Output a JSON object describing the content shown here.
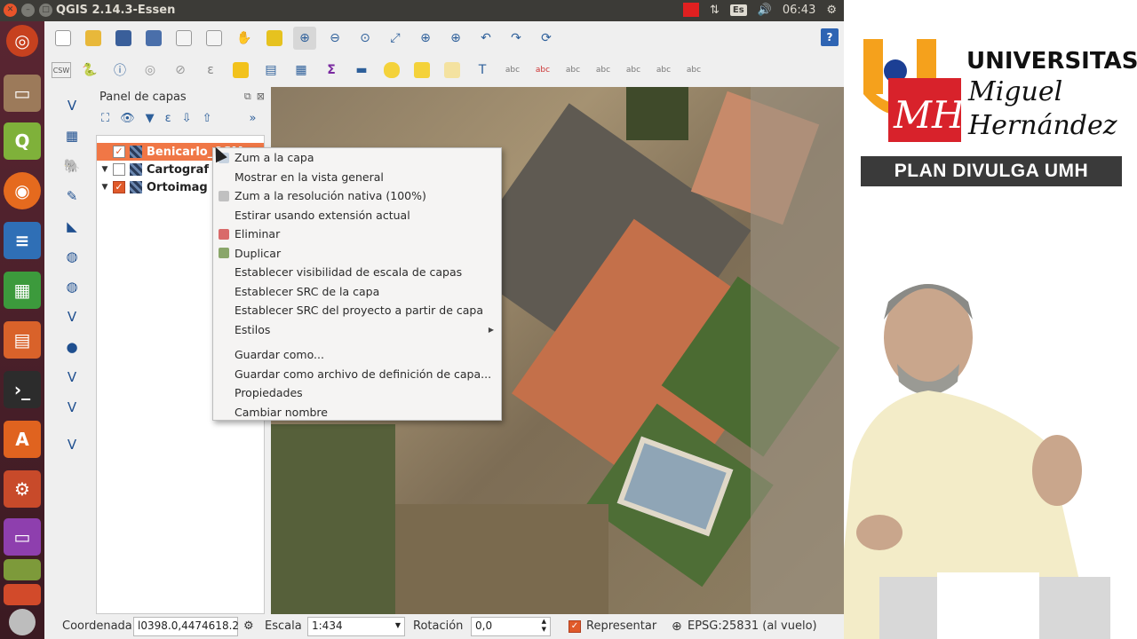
{
  "window": {
    "title": "QGIS 2.14.3-Essen"
  },
  "tray": {
    "keyboard": "Es",
    "clock": "06:43"
  },
  "panel": {
    "title": "Panel de capas"
  },
  "layers": [
    {
      "name": "Benicarlo_OSM",
      "checked": true,
      "selected": true
    },
    {
      "name": "Cartograf",
      "checked": false,
      "selected": false
    },
    {
      "name": "Ortoimag",
      "checked": true,
      "selected": false
    }
  ],
  "context_menu": {
    "items": [
      {
        "label": "Zum a la capa",
        "icon": "zoom-layer-icon"
      },
      {
        "label": "Mostrar en la vista general",
        "icon": ""
      },
      {
        "label": "Zum a la resolución nativa (100%)",
        "icon": "zoom-native-icon"
      },
      {
        "label": "Estirar usando extensión actual",
        "icon": ""
      },
      {
        "label": "Eliminar",
        "icon": "remove-icon"
      },
      {
        "label": "Duplicar",
        "icon": "duplicate-icon"
      },
      {
        "label": "Establecer visibilidad de escala de capas",
        "icon": ""
      },
      {
        "label": "Establecer SRC de la capa",
        "icon": ""
      },
      {
        "label": "Establecer SRC del proyecto a partir de capa",
        "icon": ""
      },
      {
        "label": "Estilos",
        "icon": "",
        "submenu": true
      },
      {
        "label": "Guardar como...",
        "icon": ""
      },
      {
        "label": "Guardar como archivo de definición de capa...",
        "icon": ""
      },
      {
        "label": "Propiedades",
        "icon": ""
      },
      {
        "label": "Cambiar nombre",
        "icon": ""
      }
    ]
  },
  "status": {
    "coord_label": "Coordenada",
    "coord_value": "l0398.0,4474618.2",
    "scale_label": "Escala",
    "scale_value": "1:434",
    "rotation_label": "Rotación",
    "rotation_value": "0,0",
    "render_label": "Representar",
    "crs_label": "EPSG:25831 (al vuelo)"
  },
  "branding": {
    "line1": "UNIVERSITAS",
    "line2": "Miguel",
    "line3": "Hernández",
    "banner": "PLAN DIVULGA UMH"
  },
  "colors": {
    "selection": "#f07746",
    "banner_bg": "#3a3a3a",
    "logo_orange": "#f5a11c",
    "logo_red": "#d8222b",
    "logo_blue": "#1c3f94"
  }
}
